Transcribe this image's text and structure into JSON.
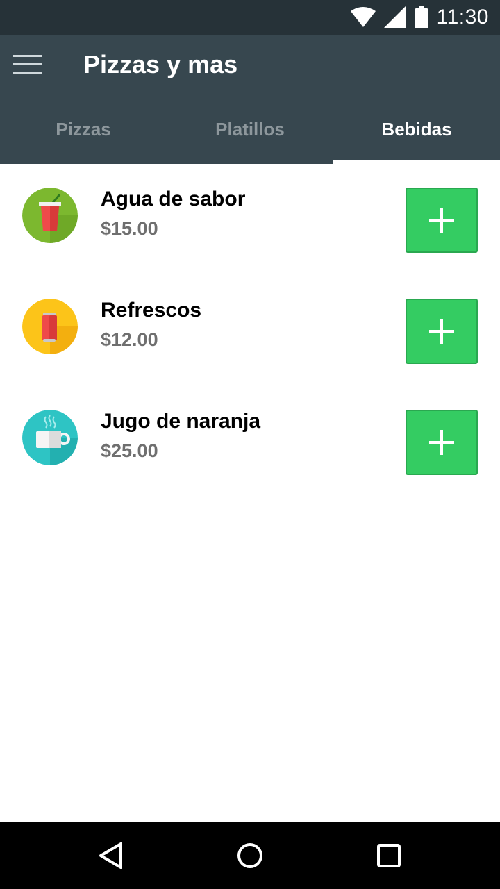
{
  "status_bar": {
    "time": "11:30"
  },
  "app_bar": {
    "title": "Pizzas y mas"
  },
  "tabs": [
    {
      "label": "Pizzas",
      "active": false
    },
    {
      "label": "Platillos",
      "active": false
    },
    {
      "label": "Bebidas",
      "active": true
    }
  ],
  "products": [
    {
      "name": "Agua de sabor",
      "price": "$15.00",
      "icon": "soda-cup-icon",
      "color": "#7cb82f"
    },
    {
      "name": "Refrescos",
      "price": "$12.00",
      "icon": "soda-can-icon",
      "color": "#fcc419"
    },
    {
      "name": "Jugo de naranja",
      "price": "$25.00",
      "icon": "coffee-mug-icon",
      "color": "#2ec4c4"
    }
  ],
  "colors": {
    "status_bar": "#263238",
    "app_bar": "#37474f",
    "add_button": "#34cc62",
    "price_text": "#6f6f6f"
  }
}
